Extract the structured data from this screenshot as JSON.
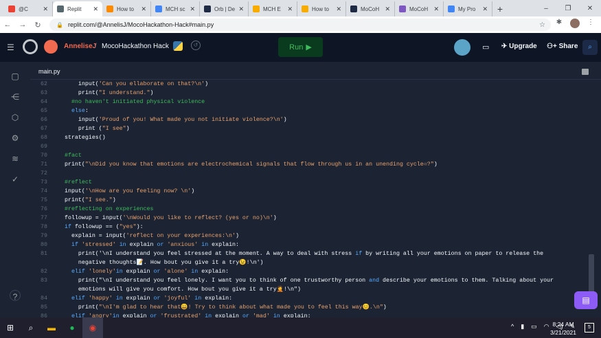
{
  "tabs": [
    {
      "title": "@C",
      "favicon_color": "#ea4335"
    },
    {
      "title": "Replit",
      "favicon_color": "#56676e",
      "active": true
    },
    {
      "title": "How to",
      "favicon_color": "#ff8a00"
    },
    {
      "title": "MCH sc",
      "favicon_color": "#4285f4"
    },
    {
      "title": "Orb | De",
      "favicon_color": "#1f2a44"
    },
    {
      "title": "MCH E",
      "favicon_color": "#f9ab00"
    },
    {
      "title": "How to",
      "favicon_color": "#f9ab00"
    },
    {
      "title": "MoCoH",
      "favicon_color": "#1f2a44"
    },
    {
      "title": "MoCoH",
      "favicon_color": "#7e57c2"
    },
    {
      "title": "My Pro",
      "favicon_color": "#4285f4"
    }
  ],
  "address": {
    "url": "replit.com/@AnnelisJ/MocoHackathon-Hack#main.py"
  },
  "header": {
    "owner": "AnneliseJ",
    "slash": "/",
    "repl_name": "MocoHackathon Hack",
    "run_label": "Run",
    "upgrade_label": "Upgrade",
    "share_label": "Share"
  },
  "editor": {
    "file_name": "main.py"
  },
  "code_lines": [
    {
      "n": "62",
      "text": "    input('Can you ellaborate on that?\\n')"
    },
    {
      "n": "63",
      "text": "    print(\"I understand.\")"
    },
    {
      "n": "64",
      "text": "  #no haven't initiated physical violence"
    },
    {
      "n": "65",
      "text": "  else:"
    },
    {
      "n": "66",
      "text": "    input('Proud of you! What made you not initiate violence?\\n')"
    },
    {
      "n": "67",
      "text": "    print (\"I see\")"
    },
    {
      "n": "68",
      "text": "strategies()"
    },
    {
      "n": "69",
      "text": ""
    },
    {
      "n": "70",
      "text": "#fact"
    },
    {
      "n": "71",
      "text": "print(\"\\nDid you know that emotions are electrochemical signals that flow through us in an unending cycle♾?\")"
    },
    {
      "n": "72",
      "text": ""
    },
    {
      "n": "73",
      "text": "#reflect"
    },
    {
      "n": "74",
      "text": "input('\\nHow are you feeling now? \\n')"
    },
    {
      "n": "75",
      "text": "print(\"I see.\")"
    },
    {
      "n": "76",
      "text": "#reflecting on experiences"
    },
    {
      "n": "77",
      "text": "followup = input('\\nWould you like to reflect? (yes or no)\\n')"
    },
    {
      "n": "78",
      "text": "if followup == (\"yes\"):"
    },
    {
      "n": "79",
      "text": "  explain = input('reflect on your experiences:\\n')"
    },
    {
      "n": "80",
      "text": "  if 'stressed' in explain or 'anxious' in explain:"
    },
    {
      "n": "81",
      "text": "    print('\\nI understand you feel stressed at the moment. A way to deal with stress if by writing all your emotions on paper to release the"
    },
    {
      "n": "",
      "text": "    negative thoughts📝. How bout you give it a try😉!\\n')"
    },
    {
      "n": "82",
      "text": "  elif 'lonely'in explain or 'alone' in explain:"
    },
    {
      "n": "83",
      "text": "    print(\"\\nI understand you feel lonely. I want you to think of one trustworthy person and describe your emotions to them. Talking about your"
    },
    {
      "n": "",
      "text": "    emotions will give you comfort. How bout you give it a try🤦!\\n\")"
    },
    {
      "n": "84",
      "text": "  elif 'happy' in explain or 'joyful' in explain:"
    },
    {
      "n": "85",
      "text": "    print(\"\\nI'm glad to hear that😀! Try to think about what made you to feel this way😊.\\n\")"
    },
    {
      "n": "86",
      "text": "  elif 'angry'in explain or 'frustrated' in explain or 'mad' in explain:"
    }
  ],
  "taskbar": {
    "time": "8:24 AM",
    "date": "3/21/2021",
    "notifications": "5"
  }
}
